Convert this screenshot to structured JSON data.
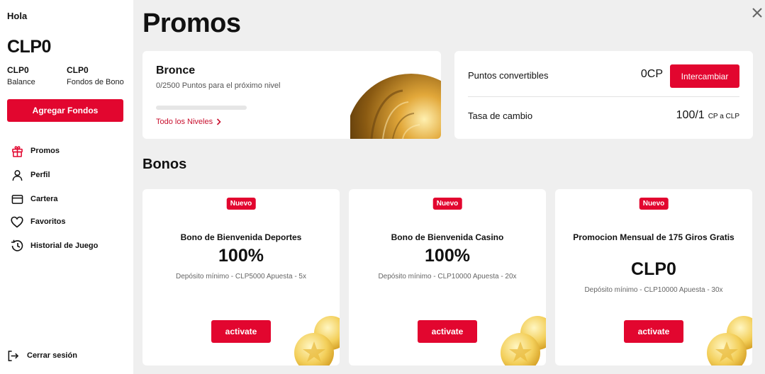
{
  "sidebar": {
    "greeting": "Hola",
    "balance_main": "CLP0",
    "balance": {
      "value": "CLP0",
      "label": "Balance"
    },
    "bonus_funds": {
      "value": "CLP0",
      "label": "Fondos de Bono"
    },
    "add_funds_label": "Agregar Fondos",
    "nav": [
      {
        "label": "Promos",
        "icon": "gift-icon"
      },
      {
        "label": "Perfil",
        "icon": "user-icon"
      },
      {
        "label": "Cartera",
        "icon": "wallet-icon"
      },
      {
        "label": "Favoritos",
        "icon": "heart-icon"
      },
      {
        "label": "Historial de Juego",
        "icon": "history-icon"
      }
    ],
    "logout_label": "Cerrar sesión"
  },
  "main": {
    "title": "Promos",
    "tier": {
      "name": "Bronce",
      "subtitle": "0/2500 Puntos para el próximo nivel",
      "progress": 0,
      "levels_link": "Todo los Niveles"
    },
    "points": {
      "convertible_label": "Puntos convertibles",
      "convertible_value": "0CP",
      "exchange_button": "Intercambiar",
      "rate_label": "Tasa de cambio",
      "rate_value": "100/1",
      "rate_unit": "CP a CLP"
    },
    "bonuses_title": "Bonos",
    "bonuses": [
      {
        "badge": "Nuevo",
        "title": "Bono de Bienvenida Deportes",
        "amount": "100%",
        "terms": "Depósito mínimo - CLP5000 Apuesta - 5x",
        "button": "activate"
      },
      {
        "badge": "Nuevo",
        "title": "Bono de Bienvenida Casino",
        "amount": "100%",
        "terms": "Depósito mínimo - CLP10000 Apuesta - 20x",
        "button": "activate"
      },
      {
        "badge": "Nuevo",
        "title": "Promocion Mensual de 175 Giros Gratis",
        "amount": "CLP0",
        "terms": "Depósito mínimo - CLP10000 Apuesta - 30x",
        "button": "activate"
      }
    ]
  },
  "colors": {
    "accent": "#e2062f",
    "link": "#c8102e",
    "background": "#efefef"
  }
}
